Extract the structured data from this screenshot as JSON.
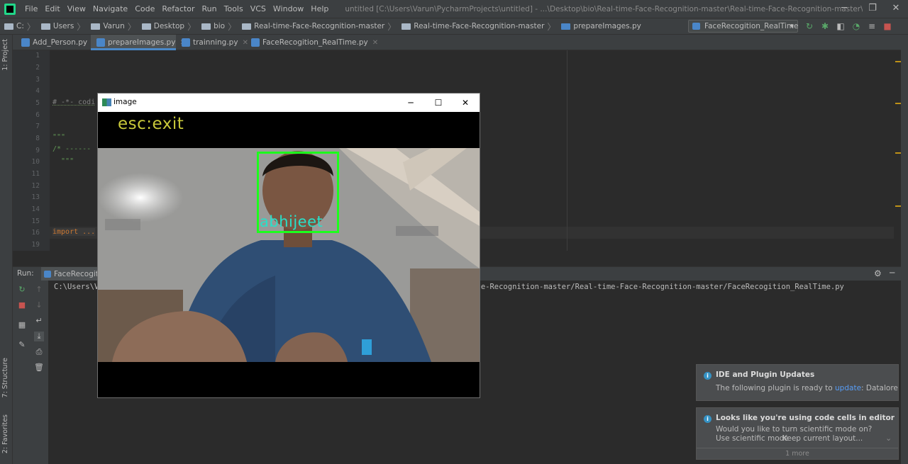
{
  "menubar": {
    "items": [
      "File",
      "Edit",
      "View",
      "Navigate",
      "Code",
      "Refactor",
      "Run",
      "Tools",
      "VCS",
      "Window",
      "Help"
    ],
    "window_title": "untitled [C:\\Users\\Varun\\PycharmProjects\\untitled] - ...\\Desktop\\bio\\Real-time-Face-Recognition-master\\Real-time-Face-Recognition-master\\prepareImages.py"
  },
  "breadcrumb": {
    "items": [
      "C:",
      "Users",
      "Varun",
      "Desktop",
      "bio",
      "Real-time-Face-Recognition-master",
      "Real-time-Face-Recognition-master",
      "prepareImages.py"
    ]
  },
  "run_config": {
    "selected": "FaceRecogition_RealTime"
  },
  "tabs": [
    {
      "label": "Add_Person.py"
    },
    {
      "label": "prepareImages.py"
    },
    {
      "label": "trainning.py"
    },
    {
      "label": "FaceRecogition_RealTime.py"
    }
  ],
  "side_tools": {
    "project": "1: Project",
    "structure": "7: Structure",
    "favorites": "2: Favorites"
  },
  "editor": {
    "line_numbers": [
      "1",
      "2",
      "3",
      "4",
      "5",
      "6",
      "7",
      "8",
      "9",
      "10",
      "11",
      "12",
      "13",
      "14",
      "15",
      "16",
      "19"
    ],
    "line5": "# -*- codi",
    "line8": "\"\"\"",
    "line9": "/* ------",
    "line10": "  \"\"\"",
    "line16": "import ..."
  },
  "run_panel": {
    "label": "Run:",
    "tab": "FaceRecogit",
    "console_start": "C:\\Users\\V",
    "console_end": "e-Face-Recognition-master/Real-time-Face-Recognition-master/FaceRecogition_RealTime.py"
  },
  "image_window": {
    "title": "image",
    "overlay_text": "esc:exit",
    "face_label": "abhijeet"
  },
  "notifications": [
    {
      "title": "IDE and Plugin Updates",
      "body_prefix": "The following plugin is ready to ",
      "link": "update",
      "body_suffix": ": Datalore"
    },
    {
      "title": "Looks like you're using code cells in editor",
      "body": "Would you like to turn scientific mode on?",
      "action1": "Use scientific mode",
      "action2": "Keep current layout...",
      "more": "1 more"
    }
  ]
}
